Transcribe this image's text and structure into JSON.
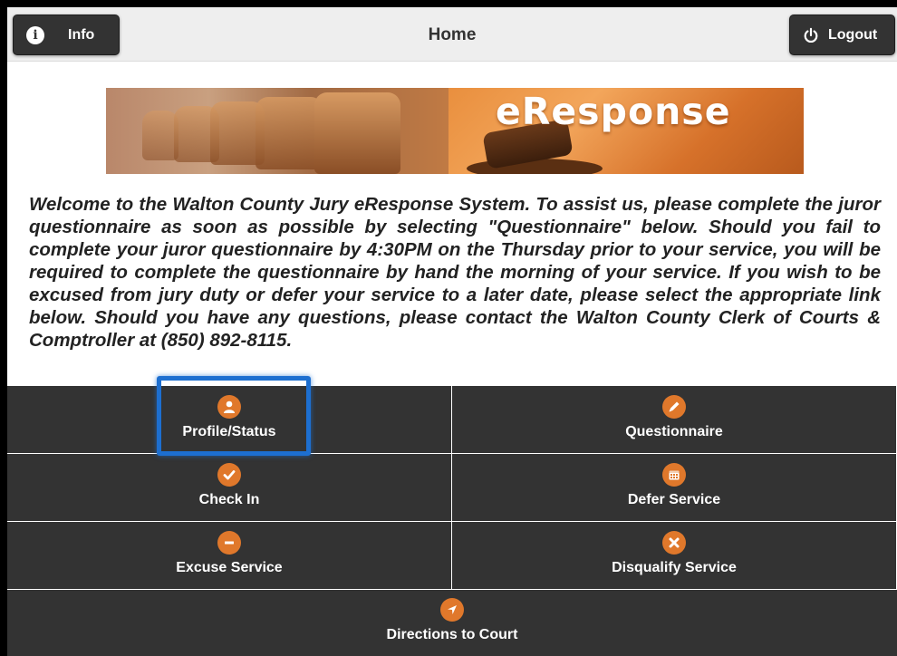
{
  "header": {
    "info_label": "Info",
    "title": "Home",
    "logout_label": "Logout"
  },
  "banner": {
    "logo_text": "eResponse"
  },
  "welcome_text": "Welcome to the Walton County Jury eResponse System. To assist us, please complete the juror questionnaire as soon as possible by selecting \"Questionnaire\" below. Should you fail to complete your juror questionnaire by 4:30PM on the Thursday prior to your service, you will be required to complete the questionnaire by hand the morning of your service. If you wish to be excused from jury duty or defer your service to a later date, please select the appropriate link below. Should you have any questions, please contact the Walton County Clerk of Courts & Comptroller at (850) 892-8115.",
  "menu": {
    "items": [
      {
        "label": "Profile/Status",
        "icon": "user-icon"
      },
      {
        "label": "Questionnaire",
        "icon": "pencil-icon"
      },
      {
        "label": "Check In",
        "icon": "checkmark-icon"
      },
      {
        "label": "Defer Service",
        "icon": "calendar-icon"
      },
      {
        "label": "Excuse Service",
        "icon": "minus-icon"
      },
      {
        "label": "Disqualify Service",
        "icon": "x-icon"
      },
      {
        "label": "Directions to Court",
        "icon": "navigation-arrow-icon"
      }
    ],
    "selected": "Profile/Status"
  },
  "colors": {
    "header_bg": "#eeeeee",
    "button_bg": "#333333",
    "tile_bg": "#333333",
    "icon_accent": "#e0782b",
    "selection": "#1d6fd0"
  }
}
